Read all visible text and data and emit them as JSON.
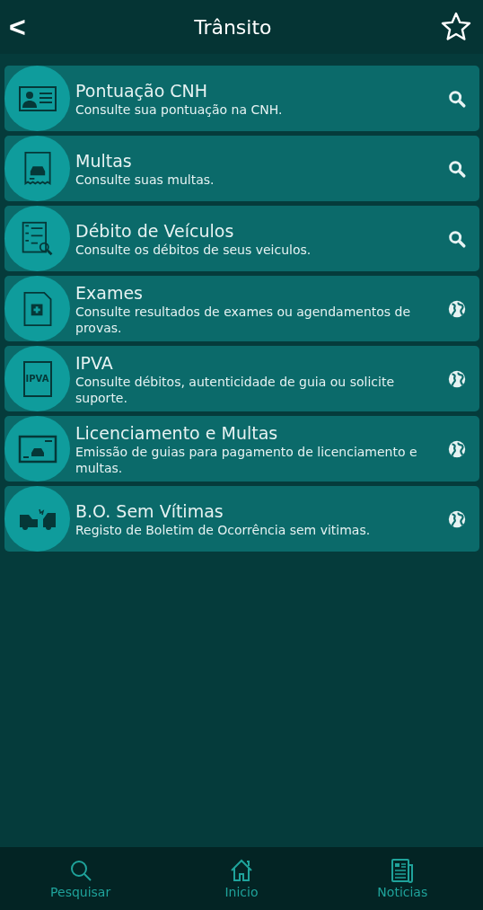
{
  "header": {
    "back": "<",
    "title": "Trânsito"
  },
  "items": [
    {
      "title": "Pontuação CNH",
      "subtitle": "Consulte sua pontuação na CNH.",
      "kind": "search"
    },
    {
      "title": "Multas",
      "subtitle": "Consulte suas multas.",
      "kind": "search"
    },
    {
      "title": "Débito de Veículos",
      "subtitle": "Consulte os débitos de seus veiculos.",
      "kind": "search"
    },
    {
      "title": "Exames",
      "subtitle": "Consulte resultados de exames ou agendamentos de provas.",
      "kind": "web"
    },
    {
      "title": "IPVA",
      "subtitle": "Consulte débitos, autenticidade de guia ou solicite suporte.",
      "kind": "web",
      "icon_text": "IPVA"
    },
    {
      "title": "Licenciamento e Multas",
      "subtitle": "Emissão de guias para pagamento de licenciamento e multas.",
      "kind": "web"
    },
    {
      "title": "B.O. Sem Vítimas",
      "subtitle": "Registo de Boletim de Ocorrência sem vitimas.",
      "kind": "web"
    }
  ],
  "nav": [
    {
      "label": "Pesquisar"
    },
    {
      "label": "Inicio"
    },
    {
      "label": "Noticias"
    }
  ]
}
